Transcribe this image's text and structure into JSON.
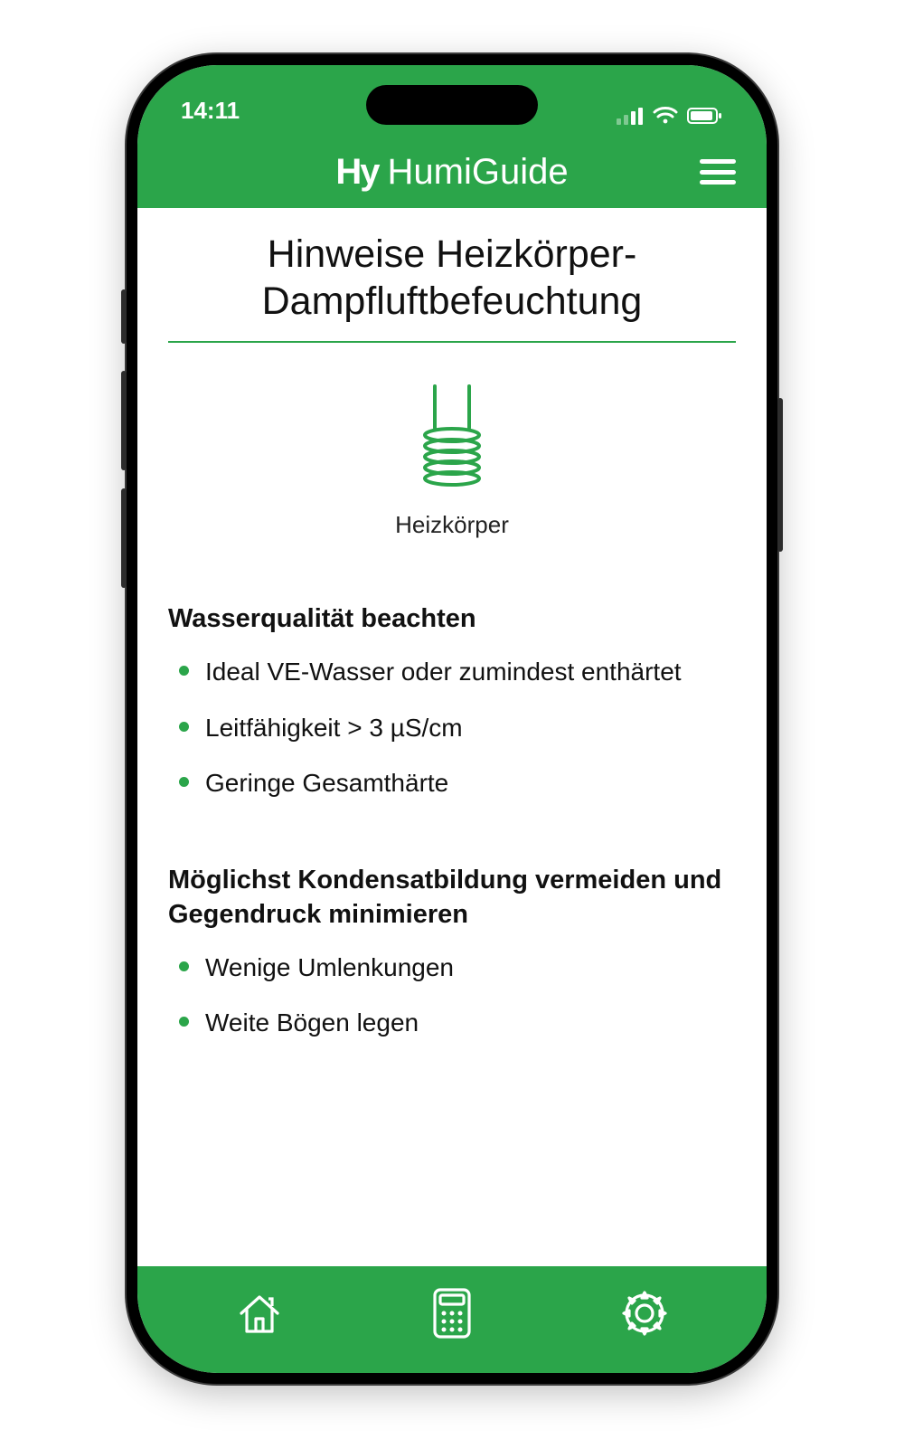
{
  "status": {
    "time": "14:11"
  },
  "header": {
    "logo": "Hy",
    "title": "HumiGuide"
  },
  "page": {
    "title": "Hinweise Heizkörper-\nDampfluftbefeuchtung",
    "hero_caption": "Heizkörper"
  },
  "sections": [
    {
      "title": "Wasserqualität beachten",
      "items": [
        "Ideal VE-Wasser oder zumindest enthärtet",
        "Leitfähigkeit > 3 µS/cm",
        "Geringe Gesamthärte"
      ]
    },
    {
      "title": "Möglichst Kondensatbildung vermeiden und Gegendruck minimieren",
      "items": [
        "Wenige Umlenkungen",
        "Weite Bögen legen"
      ]
    }
  ],
  "icons": {
    "hero": "heating-coil-icon",
    "nav_home": "home-icon",
    "nav_calc": "calculator-icon",
    "nav_settings": "gear-icon"
  },
  "colors": {
    "accent": "#2ba54a"
  }
}
